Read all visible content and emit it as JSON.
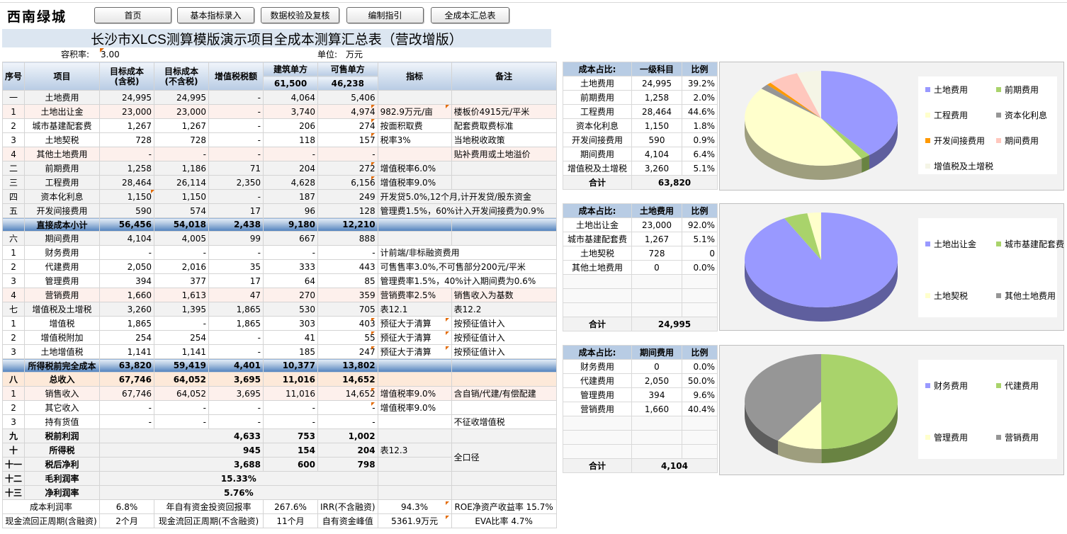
{
  "app": {
    "logo": "西南绿城"
  },
  "nav": [
    {
      "label": "首页"
    },
    {
      "label": "基本指标录入"
    },
    {
      "label": "数据校验及复核"
    },
    {
      "label": "编制指引"
    },
    {
      "label": "全成本汇总表"
    }
  ],
  "sheet": {
    "title": "长沙市XLCS测算模版演示项目全成本测算汇总表（营改增版）",
    "far_label": "容积率:",
    "far_value": "3.00",
    "unit_label": "单位:",
    "unit_value": "万元"
  },
  "table": {
    "headers": {
      "seq": "序号",
      "item": "项目",
      "target_tax": "目标成本\n(含税)",
      "target_notax": "目标成本\n(不含税)",
      "vat": "增值税税额",
      "build_unit": "建筑单方",
      "build_area": "61,500",
      "sale_unit": "可售单方",
      "sale_area": "46,238",
      "indicator": "指标",
      "remark": "备注"
    },
    "rows": [
      {
        "seq": "一",
        "item": "土地费用",
        "a": "24,995",
        "b": "24,995",
        "c": "-",
        "d": "4,064",
        "e": "5,406",
        "f": "",
        "g": "",
        "style": "alt"
      },
      {
        "seq": "1",
        "item": "土地出让金",
        "a": "23,000",
        "b": "23,000",
        "c": "-",
        "d": "3,740",
        "e": "4,974",
        "f": "982.9万元/亩",
        "g": "楼板价4915元/平米",
        "style": "pink"
      },
      {
        "seq": "2",
        "item": "城市基建配套费",
        "a": "1,267",
        "b": "1,267",
        "c": "-",
        "d": "206",
        "e": "274",
        "f": "按面积取费",
        "g": "配套费取费标准",
        "style": "r"
      },
      {
        "seq": "3",
        "item": "土地契税",
        "a": "728",
        "b": "728",
        "c": "-",
        "d": "118",
        "e": "157",
        "f": "税率3%",
        "g": "当地税收政策",
        "style": "r"
      },
      {
        "seq": "4",
        "item": "其他土地费用",
        "a": "-",
        "b": "-",
        "c": "-",
        "d": "-",
        "e": "-",
        "f": "",
        "g": "贴补费用或土地溢价",
        "style": "pink"
      },
      {
        "seq": "二",
        "item": "前期费用",
        "a": "1,258",
        "b": "1,186",
        "c": "71",
        "d": "204",
        "e": "272",
        "f": "增值税率6.0%",
        "g": "",
        "style": "alt"
      },
      {
        "seq": "三",
        "item": "工程费用",
        "a": "28,464",
        "b": "26,114",
        "c": "2,350",
        "d": "4,628",
        "e": "6,156",
        "f": "增值税率9.0%",
        "g": "",
        "style": "alt"
      },
      {
        "seq": "四",
        "item": "资本化利息",
        "a": "1,150",
        "b": "1,150",
        "c": "-",
        "d": "187",
        "e": "249",
        "f": "开发贷5.0%,12个月,计开发贷/股东资金",
        "g": "",
        "style": "alt",
        "fspan": true
      },
      {
        "seq": "五",
        "item": "开发间接费用",
        "a": "590",
        "b": "574",
        "c": "17",
        "d": "96",
        "e": "128",
        "f": "管理费1.5%，60%计入开发间接费为0.9%",
        "g": "",
        "style": "alt",
        "fspan": true
      },
      {
        "seq": "",
        "item": "直接成本小计",
        "a": "56,456",
        "b": "54,018",
        "c": "2,438",
        "d": "9,180",
        "e": "12,210",
        "f": "",
        "g": "",
        "style": "sum"
      },
      {
        "seq": "六",
        "item": "期间费用",
        "a": "4,104",
        "b": "4,005",
        "c": "99",
        "d": "667",
        "e": "888",
        "f": "",
        "g": "",
        "style": "alt"
      },
      {
        "seq": "1",
        "item": "财务费用",
        "a": "-",
        "b": "-",
        "c": "-",
        "d": "-",
        "e": "-",
        "f": "计前端/非标融资费用",
        "g": "",
        "style": "r",
        "fspan": true
      },
      {
        "seq": "2",
        "item": "代建费用",
        "a": "2,050",
        "b": "2,016",
        "c": "35",
        "d": "333",
        "e": "443",
        "f": "可售售率3.0%,不可售部分200元/平米",
        "g": "",
        "style": "r",
        "fspan": true
      },
      {
        "seq": "3",
        "item": "管理费用",
        "a": "394",
        "b": "377",
        "c": "17",
        "d": "64",
        "e": "85",
        "f": "管理费率1.5%，40%计入期间费为0.6%",
        "g": "",
        "style": "r",
        "fspan": true
      },
      {
        "seq": "4",
        "item": "营销费用",
        "a": "1,660",
        "b": "1,613",
        "c": "47",
        "d": "270",
        "e": "359",
        "f": "营销费率2.5%",
        "g": "销售收入为基数",
        "style": "pink"
      },
      {
        "seq": "七",
        "item": "增值税及土增税",
        "a": "3,260",
        "b": "1,395",
        "c": "1,865",
        "d": "530",
        "e": "705",
        "f": "表12.1",
        "g": "表12.2",
        "style": "alt"
      },
      {
        "seq": "1",
        "item": "增值税",
        "a": "1,865",
        "b": "-",
        "c": "1,865",
        "d": "303",
        "e": "403",
        "f": "预征大于清算",
        "g": "按预征值计入",
        "style": "r"
      },
      {
        "seq": "2",
        "item": "增值税附加",
        "a": "254",
        "b": "254",
        "c": "-",
        "d": "41",
        "e": "55",
        "f": "预征大于清算",
        "g": "按预征值计入",
        "style": "r"
      },
      {
        "seq": "3",
        "item": "土地增值税",
        "a": "1,141",
        "b": "1,141",
        "c": "-",
        "d": "185",
        "e": "247",
        "f": "预征大于清算",
        "g": "按预征值计入",
        "style": "r"
      },
      {
        "seq": "",
        "item": "所得税前完全成本",
        "a": "63,820",
        "b": "59,419",
        "c": "4,401",
        "d": "10,377",
        "e": "13,802",
        "f": "",
        "g": "",
        "style": "sum"
      },
      {
        "seq": "八",
        "item": "总收入",
        "a": "67,746",
        "b": "64,052",
        "c": "3,695",
        "d": "11,016",
        "e": "14,652",
        "f": "",
        "g": "",
        "style": "tot"
      },
      {
        "seq": "1",
        "item": "销售收入",
        "a": "67,746",
        "b": "64,052",
        "c": "3,695",
        "d": "11,016",
        "e": "14,652",
        "f": "增值税率9.0%",
        "g": "含自销/代建/有偿配建",
        "style": "pink"
      },
      {
        "seq": "2",
        "item": "其它收入",
        "a": "-",
        "b": "-",
        "c": "-",
        "d": "-",
        "e": "-",
        "f": "增值税率9.0%",
        "g": "",
        "style": "r"
      },
      {
        "seq": "3",
        "item": "持有货值",
        "a": "-",
        "b": "-",
        "c": "-",
        "d": "-",
        "e": "-",
        "f": "",
        "g": "不征收增值税",
        "style": "r"
      }
    ],
    "profit_rows": [
      {
        "seq": "九",
        "item": "税前利润",
        "v": "4,633",
        "d": "753",
        "e": "1,002",
        "f": ""
      },
      {
        "seq": "十",
        "item": "所得税",
        "v": "945",
        "d": "154",
        "e": "204",
        "f": "表12.3"
      },
      {
        "seq": "十一",
        "item": "税后净利",
        "v": "3,688",
        "d": "600",
        "e": "798",
        "f": ""
      }
    ],
    "remark_all": "全口径",
    "margin_rows": [
      {
        "seq": "十二",
        "item": "毛利润率",
        "v": "15.33%"
      },
      {
        "seq": "十三",
        "item": "净利润率",
        "v": "5.76%"
      }
    ],
    "bottom1": [
      "成本利润率",
      "6.8%",
      "年自有资金投资回报率",
      "267.6%",
      "IRR(不含融资)",
      "94.3%",
      "ROE净资产收益率 15.7%"
    ],
    "bottom2": [
      "现金流回正周期(含融资)",
      "2个月",
      "现金流回正周期(不含融资)",
      "11个月",
      "自有资金峰值",
      "5361.9万元",
      "EVA比率 4.7%"
    ]
  },
  "side_tables": [
    {
      "headers": [
        "成本占比:",
        "一级科目",
        "比例"
      ],
      "rows": [
        [
          "土地费用",
          "24,995",
          "39.2%"
        ],
        [
          "前期费用",
          "1,258",
          "2.0%"
        ],
        [
          "工程费用",
          "28,464",
          "44.6%"
        ],
        [
          "资本化利息",
          "1,150",
          "1.8%"
        ],
        [
          "开发间接费用",
          "590",
          "0.9%"
        ],
        [
          "期间费用",
          "4,104",
          "6.4%"
        ],
        [
          "增值税及土增税",
          "3,260",
          "5.1%"
        ]
      ],
      "total_label": "合计",
      "total": "63,820"
    },
    {
      "headers": [
        "成本占比:",
        "土地费用",
        "比例"
      ],
      "rows": [
        [
          "土地出让金",
          "23,000",
          "92.0%"
        ],
        [
          "城市基建配套费",
          "1,267",
          "5.1%"
        ],
        [
          "土地契税",
          "728",
          "0"
        ],
        [
          "其他土地费用",
          "0",
          "0.0%"
        ],
        [
          "",
          "",
          ""
        ],
        [
          "",
          "",
          ""
        ],
        [
          "",
          "",
          ""
        ]
      ],
      "total_label": "合计",
      "total": "24,995"
    },
    {
      "headers": [
        "成本占比:",
        "期间费用",
        "比例"
      ],
      "rows": [
        [
          "财务费用",
          "0",
          "0.0%"
        ],
        [
          "代建费用",
          "2,050",
          "50.0%"
        ],
        [
          "管理费用",
          "394",
          "9.6%"
        ],
        [
          "营销费用",
          "1,660",
          "40.4%"
        ],
        [
          "",
          "",
          ""
        ],
        [
          "",
          "",
          ""
        ],
        [
          "",
          "",
          ""
        ]
      ],
      "total_label": "合计",
      "total": "4,104"
    }
  ],
  "chart_data": [
    {
      "type": "pie",
      "categories": [
        "土地费用",
        "前期费用",
        "工程费用",
        "资本化利息",
        "开发间接费用",
        "期间费用",
        "增值税及土增税"
      ],
      "values": [
        24995,
        1258,
        28464,
        1150,
        590,
        4104,
        3260
      ],
      "colors": [
        "#9999ff",
        "#a9d36b",
        "#ffffcc",
        "#969696",
        "#ff9900",
        "#ffc7bd",
        "#f5f5e6"
      ],
      "legend": "right",
      "style": "3d"
    },
    {
      "type": "pie",
      "categories": [
        "土地出让金",
        "城市基建配套费",
        "土地契税",
        "其他土地费用"
      ],
      "values": [
        23000,
        1267,
        728,
        0
      ],
      "colors": [
        "#9999ff",
        "#a9d36b",
        "#ffffcc",
        "#969696"
      ],
      "legend": "right",
      "style": "3d"
    },
    {
      "type": "pie",
      "categories": [
        "财务费用",
        "代建费用",
        "管理费用",
        "营销费用"
      ],
      "values": [
        0,
        2050,
        394,
        1660
      ],
      "colors": [
        "#9999ff",
        "#a9d36b",
        "#ffffcc",
        "#969696"
      ],
      "legend": "right",
      "style": "3d"
    }
  ]
}
